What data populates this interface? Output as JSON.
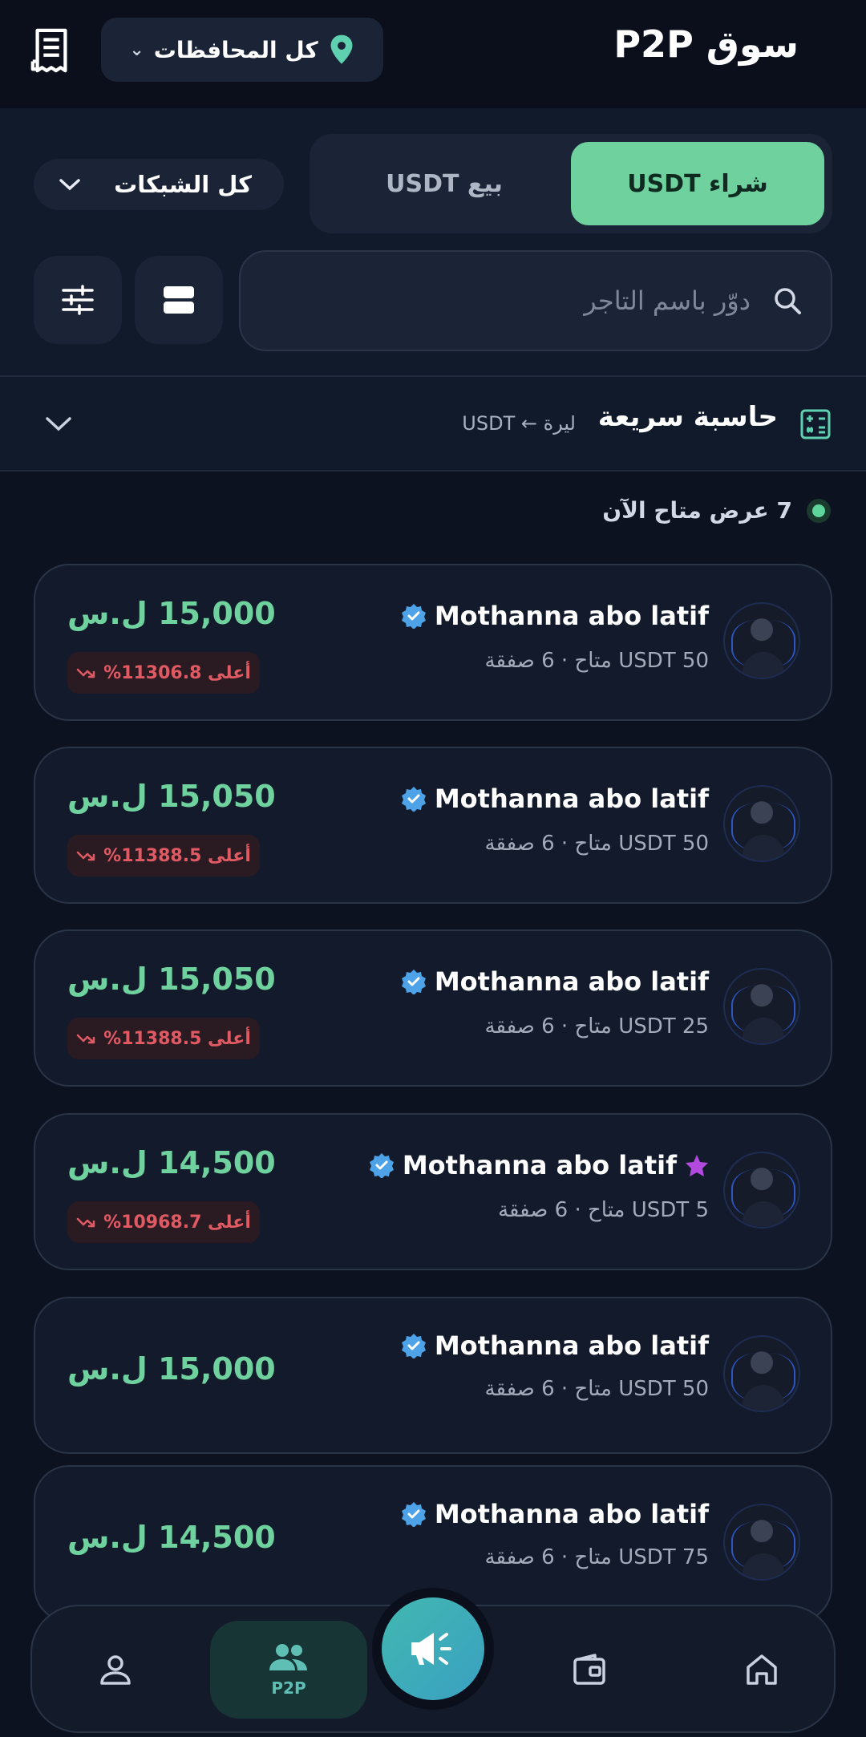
{
  "header": {
    "title": "سوق P2P",
    "governorate_label": "كل المحافظات"
  },
  "tabs": {
    "buy_label": "شراء USDT",
    "sell_label": "بيع USDT"
  },
  "network_select": {
    "label": "كل الشبكات"
  },
  "search": {
    "placeholder": "دوّر باسم التاجر"
  },
  "calculator": {
    "title": "حاسبة سريعة",
    "subtitle": "ليرة ← USDT"
  },
  "offers_status": {
    "text": "7 عرض متاح الآن"
  },
  "offers": [
    {
      "name": "Mothanna abo latif",
      "meta": "50 USDT متاح · 6 صفقة",
      "price": "15,000 ل.س",
      "diff": "أعلى 11306.8%",
      "starred": false
    },
    {
      "name": "Mothanna abo latif",
      "meta": "50 USDT متاح · 6 صفقة",
      "price": "15,050 ل.س",
      "diff": "أعلى 11388.5%",
      "starred": false
    },
    {
      "name": "Mothanna abo latif",
      "meta": "25 USDT متاح · 6 صفقة",
      "price": "15,050 ل.س",
      "diff": "أعلى 11388.5%",
      "starred": false
    },
    {
      "name": "Mothanna abo latif",
      "meta": "5 USDT متاح · 6 صفقة",
      "price": "14,500 ل.س",
      "diff": "أعلى 10968.7%",
      "starred": true
    },
    {
      "name": "Mothanna abo latif",
      "meta": "50 USDT متاح · 6 صفقة",
      "price": "15,000 ل.س",
      "diff": "",
      "starred": false
    },
    {
      "name": "Mothanna abo latif",
      "meta": "75 USDT متاح · 6 صفقة",
      "price": "14,500 ل.س",
      "diff": "",
      "starred": false
    }
  ],
  "nav": {
    "p2p_label": "P2P"
  },
  "colors": {
    "accent": "#6fd19e",
    "danger": "#e05a63",
    "background": "#0d1220"
  }
}
